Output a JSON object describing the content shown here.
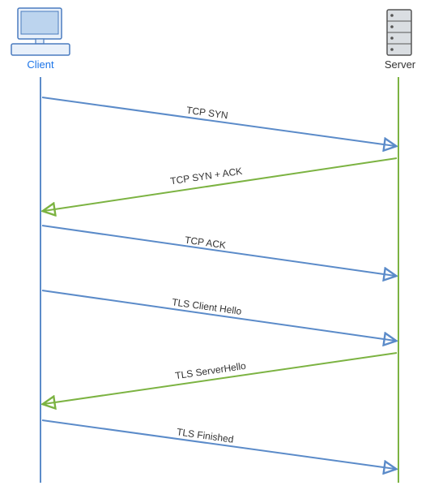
{
  "endpoints": {
    "left": "Client",
    "right": "Server"
  },
  "messages": [
    {
      "label": "TCP SYN"
    },
    {
      "label": "TCP SYN + ACK"
    },
    {
      "label": "TCP ACK"
    },
    {
      "label": "TLS Client Hello"
    },
    {
      "label": "TLS ServerHello"
    },
    {
      "label": "TLS Finished"
    }
  ],
  "colors": {
    "client_arrow": "#5b8bc9",
    "server_arrow": "#7cb342",
    "lifeline_left": "#5b8bc9",
    "lifeline_right": "#7cb342",
    "label_blue": "#1a73e8"
  }
}
